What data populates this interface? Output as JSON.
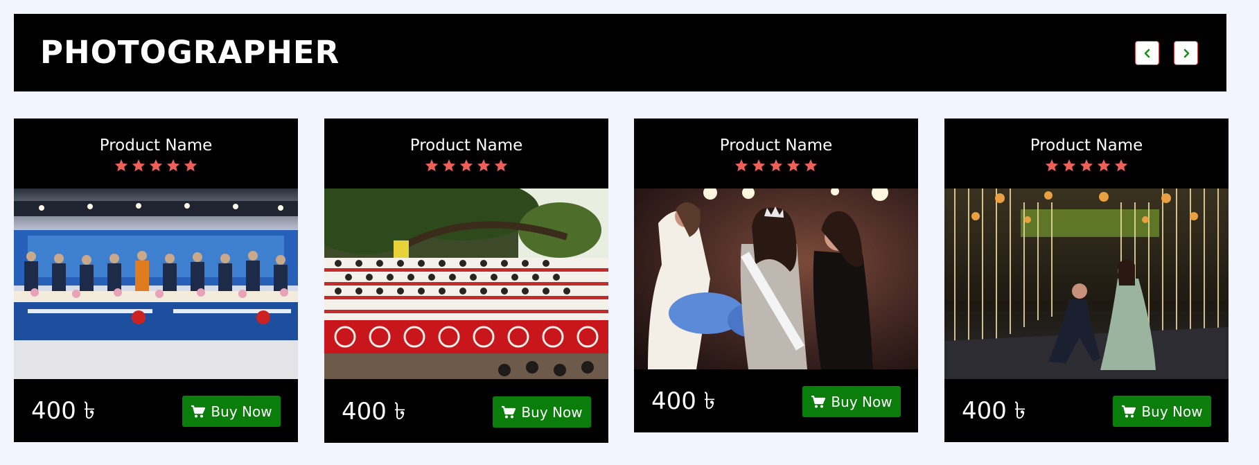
{
  "header": {
    "title": "PHOTOGRAPHER"
  },
  "colors": {
    "background": "#f2f5fe",
    "header_bg": "#000000",
    "star": "#f0605a",
    "buy_button": "#0a7d0a",
    "nav_border": "#e04040",
    "nav_chevron": "#1a8a1a"
  },
  "products": [
    {
      "name": "Product Name",
      "rating": 5,
      "price": "400 ৳",
      "buy_label": "Buy Now"
    },
    {
      "name": "Product Name",
      "rating": 5,
      "price": "400 ৳",
      "buy_label": "Buy Now"
    },
    {
      "name": "Product Name",
      "rating": 5,
      "price": "400 ৳",
      "buy_label": "Buy Now"
    },
    {
      "name": "Product Name",
      "rating": 5,
      "price": "400 ৳",
      "buy_label": "Buy Now"
    }
  ]
}
